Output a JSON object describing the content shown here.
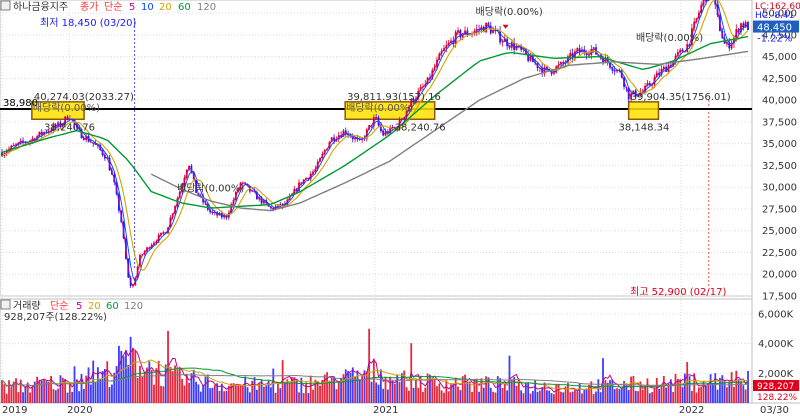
{
  "header": {
    "stock_name": "하나금융지주",
    "price_type": "종가",
    "ma_type": "단순",
    "ma_periods": [
      "5",
      "10",
      "20",
      "60",
      "120"
    ],
    "min_note": "최저 18,450 (03/20)",
    "max_note": "최고 52,900 (02/17)",
    "lc": "LC:162.60",
    "hc": "HC:-8.41"
  },
  "volume_header": {
    "title": "거래량",
    "ma_type": "단순",
    "ma_periods": [
      "5",
      "20",
      "60",
      "120"
    ],
    "value_note": "928,207주(128.22%)"
  },
  "colors": {
    "candle_up": "#e0001b",
    "candle_down": "#1a1aff",
    "ma5": "#c00099",
    "ma10": "#0044ff",
    "ma20": "#d4a400",
    "ma60": "#009933",
    "ma120": "#7f7f7f",
    "hline": "#000000",
    "box": "#ffe000",
    "box_border": "#b8860b",
    "label_current": "#1f5fbf",
    "grid": "#dcdcdc"
  },
  "chart_data": {
    "type": "candlestick",
    "y_axis": {
      "min": 17500,
      "max": 51500,
      "ticks": [
        "50,000",
        "47,500",
        "45,000",
        "42,500",
        "40,000",
        "37,500",
        "35,000",
        "32,500",
        "30,000",
        "27,500",
        "25,000",
        "22,500",
        "20,000",
        "17,500"
      ]
    },
    "x_axis": {
      "year_labels": [
        "2019",
        "2020",
        "2021",
        "2022"
      ],
      "end_label": "03/30"
    },
    "price_path": [
      [
        0,
        34000
      ],
      [
        0.02,
        34800
      ],
      [
        0.04,
        35500
      ],
      [
        0.06,
        36500
      ],
      [
        0.08,
        37200
      ],
      [
        0.09,
        38400
      ],
      [
        0.1,
        36500
      ],
      [
        0.12,
        35200
      ],
      [
        0.14,
        33500
      ],
      [
        0.15,
        30500
      ],
      [
        0.16,
        26000
      ],
      [
        0.17,
        19000
      ],
      [
        0.175,
        18450
      ],
      [
        0.185,
        22000
      ],
      [
        0.2,
        23500
      ],
      [
        0.22,
        25000
      ],
      [
        0.24,
        30000
      ],
      [
        0.25,
        33000
      ],
      [
        0.26,
        29500
      ],
      [
        0.28,
        27000
      ],
      [
        0.3,
        26500
      ],
      [
        0.32,
        30500
      ],
      [
        0.34,
        29000
      ],
      [
        0.36,
        27500
      ],
      [
        0.38,
        28000
      ],
      [
        0.4,
        30500
      ],
      [
        0.42,
        32000
      ],
      [
        0.44,
        35500
      ],
      [
        0.46,
        36500
      ],
      [
        0.48,
        35000
      ],
      [
        0.5,
        38000
      ],
      [
        0.51,
        36000
      ],
      [
        0.53,
        37000
      ],
      [
        0.55,
        40000
      ],
      [
        0.57,
        42000
      ],
      [
        0.59,
        45500
      ],
      [
        0.61,
        47500
      ],
      [
        0.63,
        47800
      ],
      [
        0.65,
        48500
      ],
      [
        0.67,
        47000
      ],
      [
        0.69,
        46000
      ],
      [
        0.71,
        44500
      ],
      [
        0.73,
        43200
      ],
      [
        0.75,
        44000
      ],
      [
        0.77,
        45500
      ],
      [
        0.79,
        45800
      ],
      [
        0.81,
        44500
      ],
      [
        0.83,
        43000
      ],
      [
        0.84,
        40500
      ],
      [
        0.86,
        41000
      ],
      [
        0.88,
        43000
      ],
      [
        0.9,
        44500
      ],
      [
        0.92,
        46500
      ],
      [
        0.94,
        51500
      ],
      [
        0.95,
        52900
      ],
      [
        0.96,
        49000
      ],
      [
        0.97,
        46000
      ],
      [
        0.98,
        47000
      ],
      [
        0.99,
        48800
      ],
      [
        1,
        48450
      ]
    ],
    "ma60_path": [
      [
        0,
        34000
      ],
      [
        0.06,
        35600
      ],
      [
        0.1,
        36500
      ],
      [
        0.14,
        35500
      ],
      [
        0.17,
        33000
      ],
      [
        0.2,
        29500
      ],
      [
        0.24,
        28200
      ],
      [
        0.28,
        27600
      ],
      [
        0.32,
        27800
      ],
      [
        0.36,
        28000
      ],
      [
        0.4,
        29500
      ],
      [
        0.46,
        32500
      ],
      [
        0.52,
        36000
      ],
      [
        0.58,
        40500
      ],
      [
        0.64,
        44500
      ],
      [
        0.68,
        45500
      ],
      [
        0.74,
        44800
      ],
      [
        0.8,
        45000
      ],
      [
        0.86,
        43500
      ],
      [
        0.9,
        44500
      ],
      [
        0.95,
        46500
      ],
      [
        1,
        47300
      ]
    ],
    "ma120_path": [
      [
        0.2,
        31500
      ],
      [
        0.24,
        29800
      ],
      [
        0.28,
        28400
      ],
      [
        0.32,
        27600
      ],
      [
        0.36,
        27300
      ],
      [
        0.4,
        28200
      ],
      [
        0.46,
        30500
      ],
      [
        0.52,
        33000
      ],
      [
        0.58,
        36500
      ],
      [
        0.64,
        40000
      ],
      [
        0.7,
        42500
      ],
      [
        0.76,
        44000
      ],
      [
        0.82,
        44400
      ],
      [
        0.88,
        44100
      ],
      [
        0.94,
        44800
      ],
      [
        1,
        45600
      ]
    ],
    "current_price": "48,450",
    "change_pct": "-1.22%",
    "horizontal_line": {
      "value": 38980,
      "label": "38,980"
    },
    "highlight_boxes": [
      {
        "x_from": 0.04,
        "x_to": 0.11,
        "low": 37800,
        "high": 39800,
        "upper_label": "40,274.03(2033.27)",
        "lower_label": "38,240.76",
        "box_label": "배당락(0.00%)"
      },
      {
        "x_from": 0.46,
        "x_to": 0.58,
        "low": 37800,
        "high": 39800,
        "upper_label": "39,811.93(157).16",
        "lower_label": "38,240.76",
        "box_label": "배당락(0.00%)"
      },
      {
        "x_from": 0.84,
        "x_to": 0.88,
        "low": 37800,
        "high": 39800,
        "upper_label": "39,904.35(1756.01)",
        "lower_label": "38,148.34",
        "box_label": ""
      }
    ],
    "annotations": [
      {
        "x": 0.275,
        "y": 29500,
        "text": "배당락(0.00%)"
      },
      {
        "x": 0.675,
        "y": 49800,
        "text": "배당락(0.00%)"
      },
      {
        "x": 0.89,
        "y": 46800,
        "text": "배당락(0.00%)"
      }
    ],
    "min_point": {
      "x": 0.175,
      "value": 18450
    },
    "max_point": {
      "x": 0.95,
      "value": 52900
    }
  },
  "volume_data": {
    "type": "bar",
    "y_ticks": [
      "6,000K",
      "4,000K",
      "2,000K"
    ],
    "y_max": 7000,
    "current_volume": "928,207",
    "current_pct": "128.22%",
    "profile": [
      [
        0,
        1200
      ],
      [
        0.05,
        1400
      ],
      [
        0.1,
        1600
      ],
      [
        0.14,
        2200
      ],
      [
        0.17,
        3500
      ],
      [
        0.2,
        2600
      ],
      [
        0.23,
        1900
      ],
      [
        0.28,
        1500
      ],
      [
        0.34,
        1300
      ],
      [
        0.4,
        1400
      ],
      [
        0.46,
        1800
      ],
      [
        0.5,
        2300
      ],
      [
        0.52,
        1800
      ],
      [
        0.58,
        1500
      ],
      [
        0.64,
        1400
      ],
      [
        0.7,
        1300
      ],
      [
        0.76,
        1200
      ],
      [
        0.82,
        1300
      ],
      [
        0.86,
        1400
      ],
      [
        0.92,
        1500
      ],
      [
        0.96,
        1700
      ],
      [
        1,
        1100
      ]
    ]
  }
}
